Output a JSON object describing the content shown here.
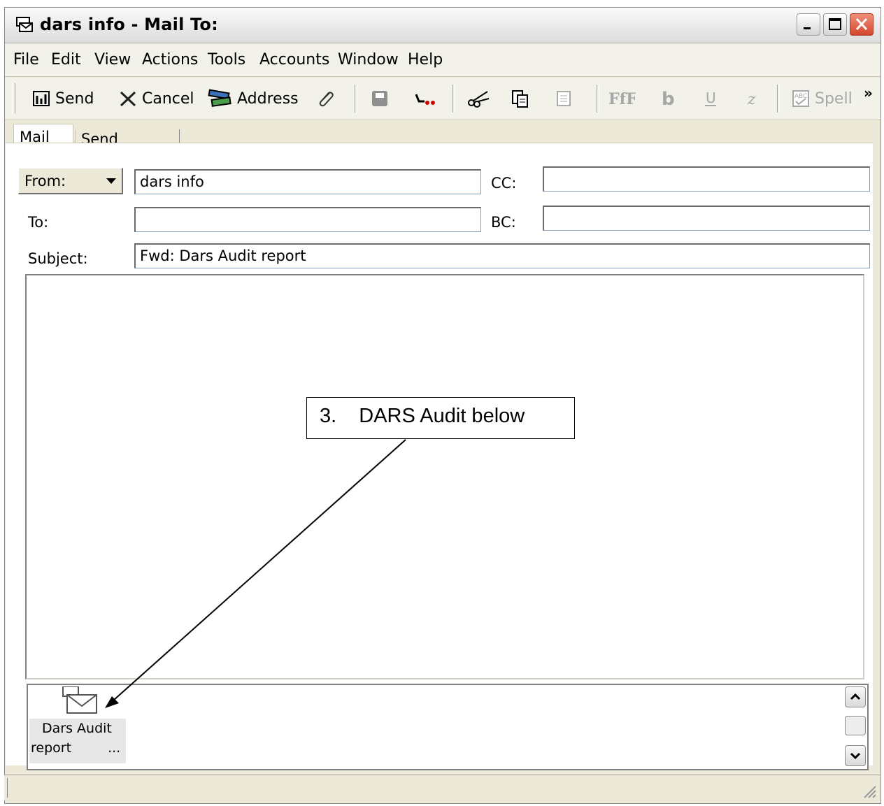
{
  "window": {
    "title": "dars info - Mail To:"
  },
  "menu": [
    "File",
    "Edit",
    "View",
    "Actions",
    "Tools",
    "Accounts",
    "Window",
    "Help"
  ],
  "toolbar": {
    "send": "Send",
    "cancel": "Cancel",
    "address": "Address",
    "spell": "Spell"
  },
  "tabs": [
    "Mail",
    "Send Options"
  ],
  "form": {
    "from_label": "From:",
    "from_value": "dars info",
    "to_label": "To:",
    "to_value": "",
    "subject_label": "Subject:",
    "subject_value": "Fwd: Dars Audit report",
    "cc_label": "CC:",
    "cc_value": "",
    "bc_label": "BC:",
    "bc_value": ""
  },
  "attachment": {
    "name_line1": "Dars Audit",
    "name_line2": "report",
    "ellipsis": "..."
  },
  "callout": {
    "number": "3.",
    "text": "DARS Audit below"
  },
  "colors": {
    "close_button": "#d3462e",
    "field_border": "#7f9db9",
    "chrome": "#ece9d8"
  }
}
